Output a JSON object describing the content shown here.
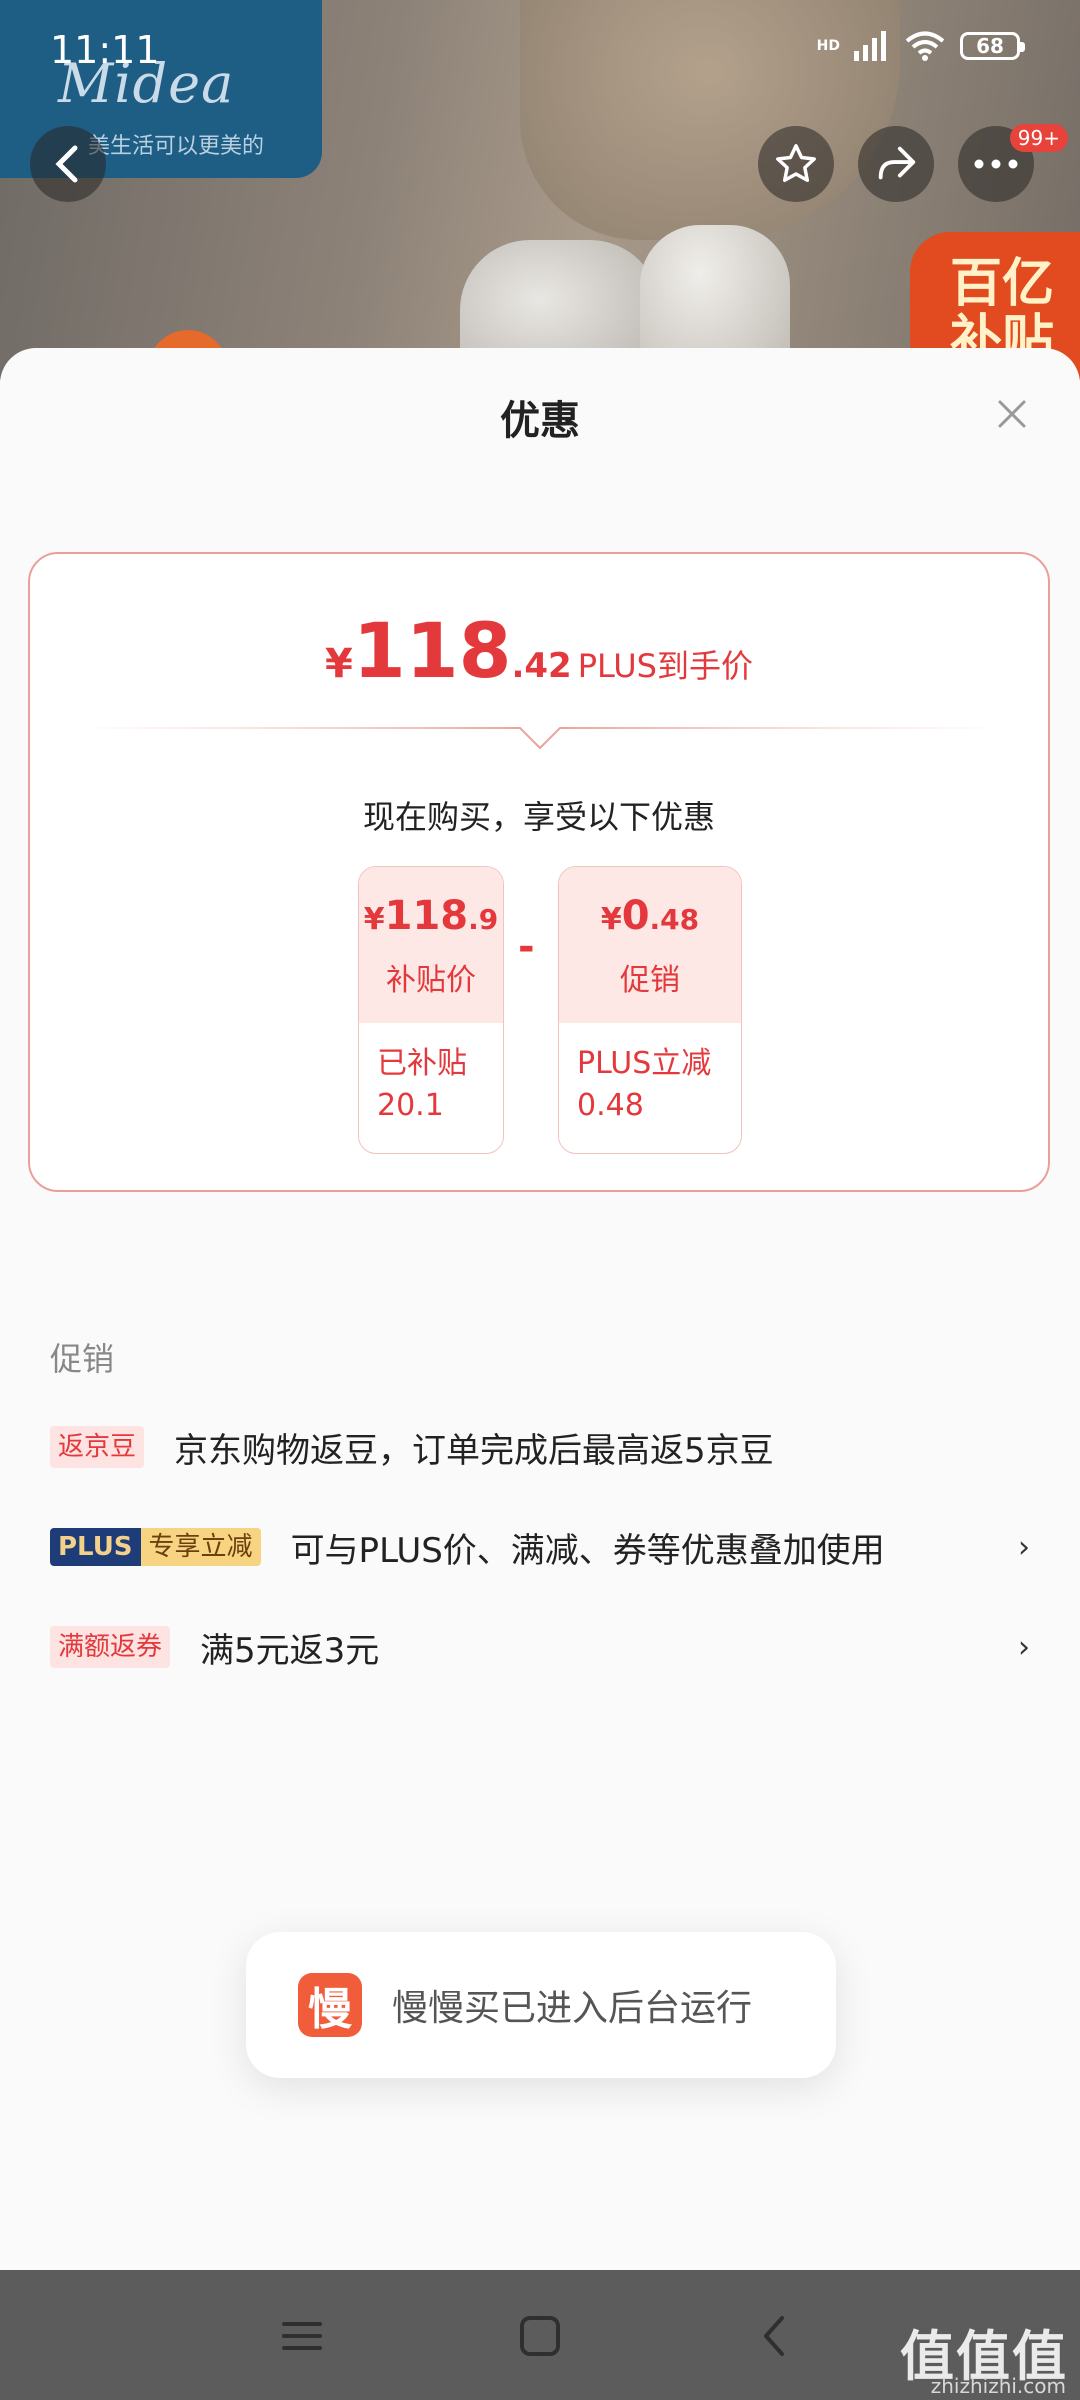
{
  "status_bar": {
    "time": "11:11",
    "network": "HD",
    "battery": "68"
  },
  "backdrop": {
    "brand_logo": "Midea",
    "brand_slogan": "美生活可以更美的",
    "promo_tag_line1": "百亿",
    "promo_tag_line2": "补贴"
  },
  "header": {
    "more_badge": "99+"
  },
  "sheet": {
    "title": "优惠",
    "price_summary": {
      "currency": "¥",
      "integer": "118",
      "decimal": ".42",
      "label": "PLUS到手价",
      "subtitle": "现在购买，享受以下优惠"
    },
    "breakdown": [
      {
        "currency": "¥",
        "integer": "118",
        "decimal": ".9",
        "label": "补贴价",
        "detail_line1": "已补贴",
        "detail_line2": "20.1"
      },
      {
        "currency": "¥",
        "integer": "0",
        "decimal": ".48",
        "label": "促销",
        "detail_line1": "PLUS立减",
        "detail_line2": "0.48"
      }
    ],
    "operator": "-",
    "promotions": {
      "heading": "促销",
      "items": [
        {
          "tag": "返京豆",
          "text": "京东购物返豆，订单完成后最高返5京豆"
        },
        {
          "tag_part1": "PLUS",
          "tag_part2": "专享立减",
          "text": "可与PLUS价、满减、券等优惠叠加使用",
          "chevron": "›"
        },
        {
          "tag": "满额返券",
          "text": "满5元返3元",
          "chevron": "›"
        }
      ]
    }
  },
  "toast": {
    "icon_char": "慢",
    "text": "慢慢买已进入后台运行"
  },
  "watermark": {
    "main": "值值值",
    "sub": "zhizhizhi.com"
  },
  "colors": {
    "accent": "#e4393c",
    "plus_navy": "#1e3c78",
    "plus_gold": "#f7d482"
  }
}
